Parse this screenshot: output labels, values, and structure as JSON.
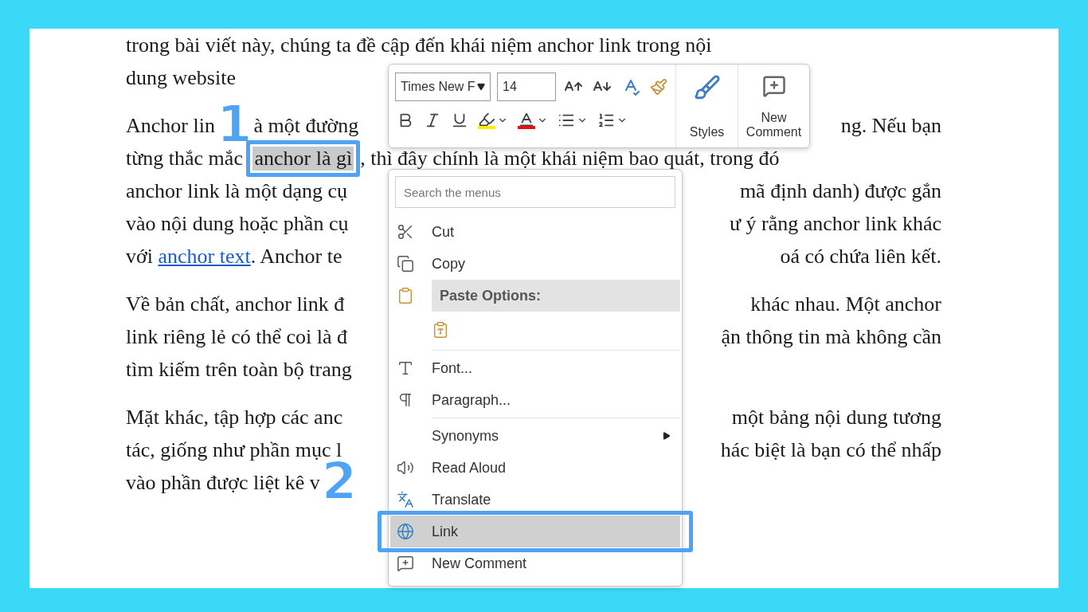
{
  "document": {
    "paragraphs": [
      {
        "lines": [
          {
            "segments": [
              {
                "kind": "text",
                "text": "trong bài viết này, chúng ta đề cập đến khái niệm anchor link trong nội"
              }
            ]
          },
          {
            "segments": [
              {
                "kind": "text",
                "text": "dung website"
              }
            ]
          }
        ]
      },
      {
        "lines": [
          {
            "segments": [
              {
                "kind": "text",
                "text": "Anchor lin"
              },
              {
                "kind": "step",
                "text": "1"
              },
              {
                "kind": "text",
                "text": "à một đường"
              }
            ],
            "right": "ng. Nếu bạn"
          },
          {
            "segments": [
              {
                "kind": "text",
                "text": "từng thắc mắc "
              },
              {
                "kind": "highlight",
                "text": "anchor là gì"
              },
              {
                "kind": "text",
                "text": ", thì đây chính là một khái niệm bao quát, trong đó"
              }
            ]
          },
          {
            "segments": [
              {
                "kind": "text",
                "text": "anchor link là một dạng cụ"
              }
            ],
            "right": "mã định danh) được gắn"
          },
          {
            "segments": [
              {
                "kind": "text",
                "text": "vào nội dung hoặc phần cụ"
              }
            ],
            "right": "ư ý rằng anchor link khác"
          },
          {
            "segments": [
              {
                "kind": "text",
                "text": "với "
              },
              {
                "kind": "link",
                "text": "anchor text"
              },
              {
                "kind": "text",
                "text": ". Anchor te"
              }
            ],
            "right": "oá có chứa liên kết."
          }
        ]
      },
      {
        "lines": [
          {
            "segments": [
              {
                "kind": "text",
                "text": "Về bản chất, anchor link đ"
              }
            ],
            "right": "khác nhau. Một anchor"
          },
          {
            "segments": [
              {
                "kind": "text",
                "text": "link riêng lẻ có thể coi là đ"
              }
            ],
            "right": "ận thông tin mà không cần"
          },
          {
            "segments": [
              {
                "kind": "text",
                "text": "tìm kiếm trên toàn bộ trang"
              }
            ]
          }
        ]
      },
      {
        "lines": [
          {
            "segments": [
              {
                "kind": "text",
                "text": "Mặt khác, tập hợp các anc"
              }
            ],
            "right": "một bảng nội dung tương"
          },
          {
            "segments": [
              {
                "kind": "text",
                "text": "tác, giống như phần mục l"
              }
            ],
            "right": "hác biệt là bạn có thể nhấp"
          },
          {
            "segments": [
              {
                "kind": "text",
                "text": "vào phần được liệt kê v"
              },
              {
                "kind": "step",
                "text": "2"
              }
            ]
          }
        ]
      }
    ]
  },
  "mini_toolbar": {
    "font": "Times New F",
    "size": "14",
    "styles_label": "Styles",
    "comment_label": "New Comment",
    "format_buttons": [
      {
        "kind": "bold"
      },
      {
        "kind": "italic"
      },
      {
        "kind": "underline"
      },
      {
        "kind": "highlight",
        "color": "#ffee00"
      },
      {
        "kind": "font-color",
        "color": "#e81010"
      },
      {
        "kind": "bullets"
      },
      {
        "kind": "numbering"
      }
    ]
  },
  "context_menu": {
    "search": {
      "placeholder": "Search the menus"
    },
    "items": [
      {
        "kind": "item",
        "label": "Cut",
        "selected": false,
        "submenu": false,
        "annotated": false
      },
      {
        "kind": "item",
        "label": "Copy",
        "selected": false,
        "submenu": false,
        "annotated": false
      },
      {
        "kind": "header",
        "label": "Paste Options:"
      },
      {
        "kind": "paste"
      },
      {
        "kind": "separator"
      },
      {
        "kind": "item",
        "label": "Font...",
        "selected": false,
        "submenu": false,
        "annotated": false
      },
      {
        "kind": "item",
        "label": "Paragraph...",
        "selected": false,
        "submenu": false,
        "annotated": false
      },
      {
        "kind": "separator"
      },
      {
        "kind": "item",
        "label": "Synonyms",
        "selected": false,
        "submenu": true,
        "annotated": false
      },
      {
        "kind": "item",
        "label": "Read Aloud",
        "selected": false,
        "submenu": false,
        "annotated": false
      },
      {
        "kind": "item",
        "label": "Translate",
        "selected": false,
        "submenu": false,
        "annotated": false
      },
      {
        "kind": "item",
        "label": "Link",
        "selected": true,
        "submenu": false,
        "annotated": true
      },
      {
        "kind": "item",
        "label": "New Comment",
        "selected": false,
        "submenu": false,
        "annotated": false
      }
    ]
  }
}
